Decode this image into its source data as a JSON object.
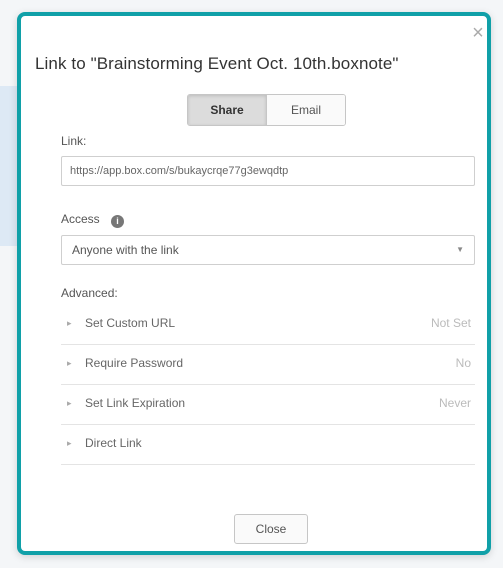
{
  "dialog": {
    "title": "Link to \"Brainstorming Event Oct. 10th.boxnote\"",
    "close_glyph": "×",
    "accent_color": "#10a0a8"
  },
  "tabs": [
    {
      "label": "Share",
      "active": true
    },
    {
      "label": "Email",
      "active": false
    }
  ],
  "link": {
    "label": "Link:",
    "value": "https://app.box.com/s/bukaycrqe77g3ewqdtp"
  },
  "access": {
    "label": "Access",
    "info_icon": "info-icon",
    "selected": "Anyone with the link"
  },
  "advanced": {
    "label": "Advanced:",
    "items": [
      {
        "name": "Set Custom URL",
        "value": "Not Set"
      },
      {
        "name": "Require Password",
        "value": "No"
      },
      {
        "name": "Set Link Expiration",
        "value": "Never"
      },
      {
        "name": "Direct Link",
        "value": ""
      }
    ]
  },
  "footer": {
    "close_label": "Close"
  }
}
